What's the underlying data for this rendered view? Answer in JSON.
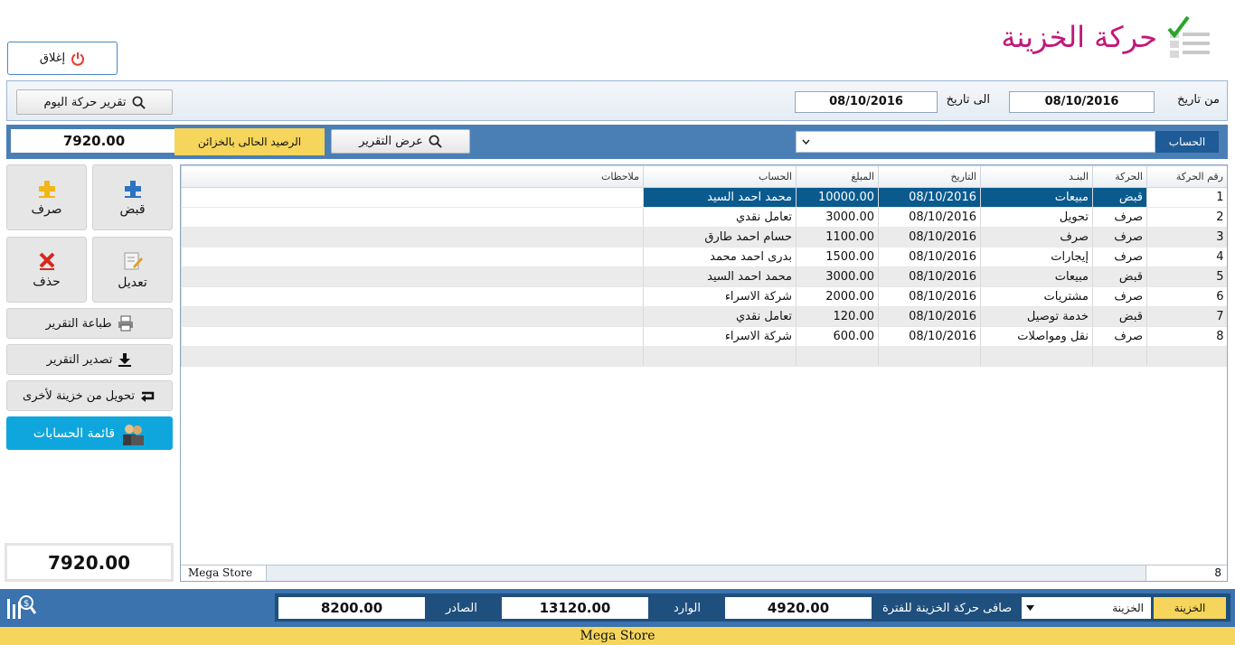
{
  "header": {
    "title": "حركة الخزينة",
    "close_label": "إغلاق"
  },
  "filters": {
    "from_label": "من تاريخ",
    "from_value": "08/10/2016",
    "to_label": "الى تاريخ",
    "to_value": "08/10/2016",
    "today_report_label": "تقرير حركة اليوم"
  },
  "account_bar": {
    "account_label": "الحساب",
    "show_report_label": "عرض التقرير",
    "balance_label": "الرصيد الحالى بالخزائن",
    "balance_value": "7920.00"
  },
  "actions": {
    "receive_label": "قبض",
    "pay_label": "صرف",
    "edit_label": "تعديل",
    "delete_label": "حذف",
    "print_label": "طباعة التقرير",
    "export_label": "تصدير التقرير",
    "transfer_label": "تحويل من خزينة لأخرى",
    "accounts_list_label": "قائمة الحسابات",
    "total_value": "7920.00"
  },
  "table": {
    "headers": [
      "رقم الحركة",
      "الحركة",
      "البنـد",
      "التاريخ",
      "المبلغ",
      "الحساب",
      "ملاحظات"
    ],
    "rows": [
      [
        "1",
        "قبض",
        "مبيعات",
        "08/10/2016",
        "10000.00",
        "محمد احمد السيد",
        ""
      ],
      [
        "2",
        "صرف",
        "تحويل",
        "08/10/2016",
        "3000.00",
        "تعامل نقدي",
        ""
      ],
      [
        "3",
        "صرف",
        "صرف",
        "08/10/2016",
        "1100.00",
        "حسام احمد طارق",
        ""
      ],
      [
        "4",
        "صرف",
        "إيجارات",
        "08/10/2016",
        "1500.00",
        "بدرى احمد محمد",
        ""
      ],
      [
        "5",
        "قبض",
        "مبيعات",
        "08/10/2016",
        "3000.00",
        "محمد احمد السيد",
        ""
      ],
      [
        "6",
        "صرف",
        "مشتريات",
        "08/10/2016",
        "2000.00",
        "شركة الاسراء",
        ""
      ],
      [
        "7",
        "قبض",
        "خدمة توصيل",
        "08/10/2016",
        "120.00",
        "تعامل نقدي",
        ""
      ],
      [
        "8",
        "صرف",
        "نقل ومواصلات",
        "08/10/2016",
        "600.00",
        "شركة الاسراء",
        ""
      ]
    ],
    "footer_left": "Mega Store",
    "footer_count": "8"
  },
  "summary": {
    "treasury_label": "الخزينة",
    "treasury_value": "الخزينة",
    "net_label": "صافى حركة الخزينة للفترة",
    "net_value": "4920.00",
    "incoming_label": "الوارد",
    "incoming_value": "13120.00",
    "outgoing_label": "الصادر",
    "outgoing_value": "8200.00"
  },
  "status_bar": {
    "text": "Mega Store"
  },
  "colors": {
    "title": "#c2187a",
    "accent_blue": "#4a7fb6",
    "highlight_yellow": "#f5d55b",
    "selected_row": "#0a5a8e",
    "accounts_button": "#0fa6dd"
  }
}
